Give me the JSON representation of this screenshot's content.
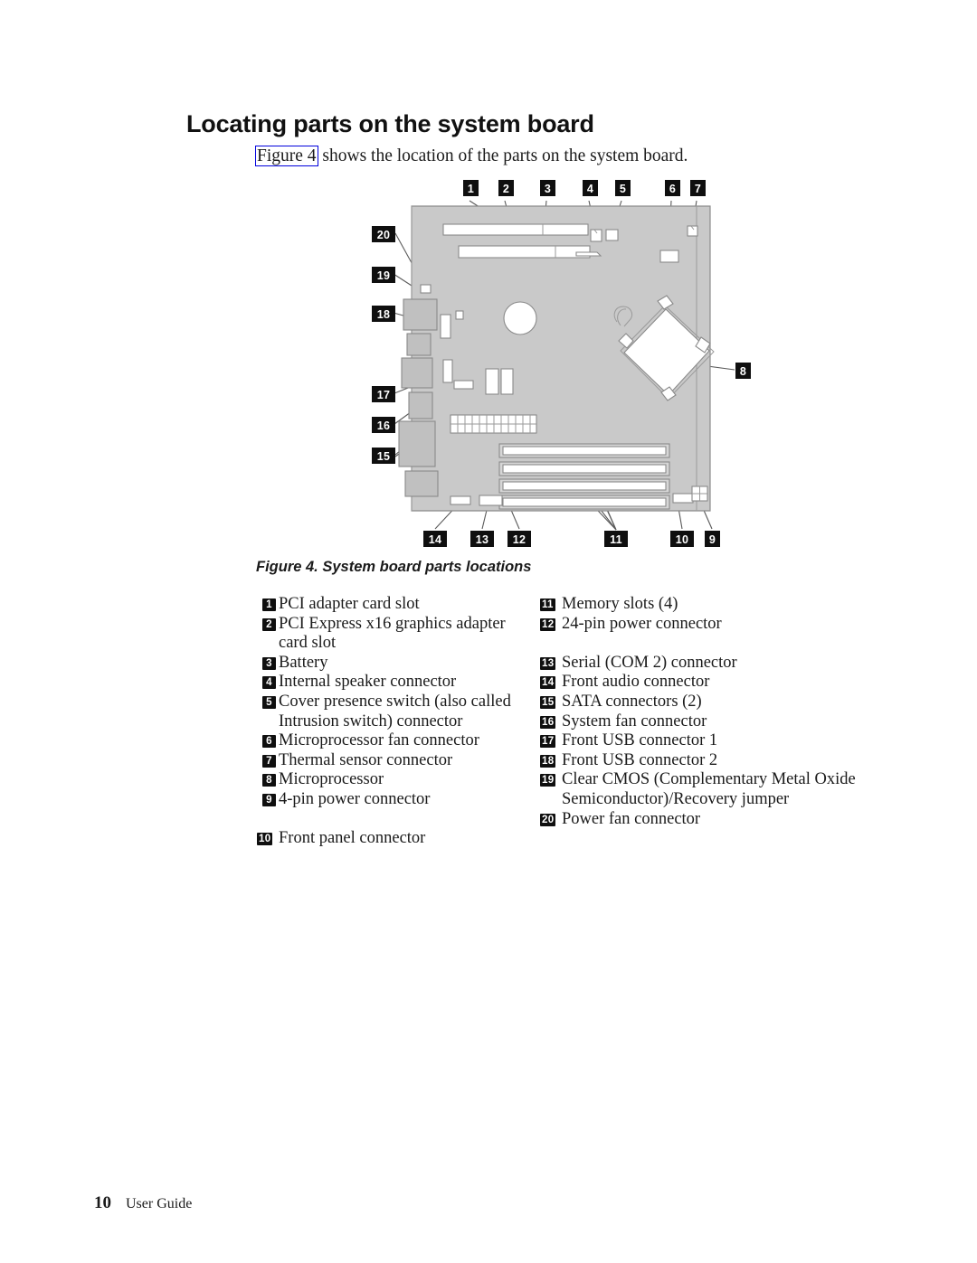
{
  "document": {
    "title": "Locating parts on the system board",
    "intro_link": "Figure 4",
    "intro_rest": " shows the location of the parts on the system board.",
    "figure_caption": "Figure 4. System board parts locations"
  },
  "footer": {
    "page_number": "10",
    "guide_title": "User Guide"
  },
  "legend": {
    "left": [
      {
        "num": "1",
        "label": "PCI adapter card slot"
      },
      {
        "num": "2",
        "label": "PCI Express x16 graphics adapter card slot"
      },
      {
        "num": "3",
        "label": "Battery"
      },
      {
        "num": "4",
        "label": "Internal speaker connector"
      },
      {
        "num": "5",
        "label": "Cover presence switch (also called Intrusion switch) connector"
      },
      {
        "num": "6",
        "label": "Microprocessor fan connector"
      },
      {
        "num": "7",
        "label": "Thermal sensor connector"
      },
      {
        "num": "8",
        "label": "Microprocessor"
      },
      {
        "num": "9",
        "label": "4-pin power connector"
      },
      {
        "num": "10",
        "label": "Front panel connector"
      }
    ],
    "right": [
      {
        "num": "11",
        "label": "Memory slots (4)"
      },
      {
        "num": "12",
        "label": "24-pin power connector"
      },
      {
        "num": "13",
        "label": "Serial (COM 2) connector"
      },
      {
        "num": "14",
        "label": "Front audio connector"
      },
      {
        "num": "15",
        "label": "SATA connectors (2)"
      },
      {
        "num": "16",
        "label": "System fan connector"
      },
      {
        "num": "17",
        "label": "Front USB connector 1"
      },
      {
        "num": "18",
        "label": "Front USB connector 2"
      },
      {
        "num": "19",
        "label": "Clear CMOS (Complementary Metal Oxide Semiconductor)/Recovery jumper"
      },
      {
        "num": "20",
        "label": "Power fan connector"
      }
    ]
  },
  "figure_callouts": {
    "top": [
      "1",
      "2",
      "3",
      "4",
      "5",
      "6",
      "7"
    ],
    "right": [
      "8"
    ],
    "bottom": [
      "14",
      "13",
      "12",
      "11",
      "10",
      "9"
    ],
    "left": [
      "20",
      "19",
      "18",
      "17",
      "16",
      "15"
    ]
  },
  "colors": {
    "board": "#c9c9c9",
    "badge": "#0f0f0f",
    "badge_text": "#ffffff",
    "link_border": "#0000dd",
    "leader_line": "#5a5a5a",
    "text": "#1a1a1a"
  }
}
